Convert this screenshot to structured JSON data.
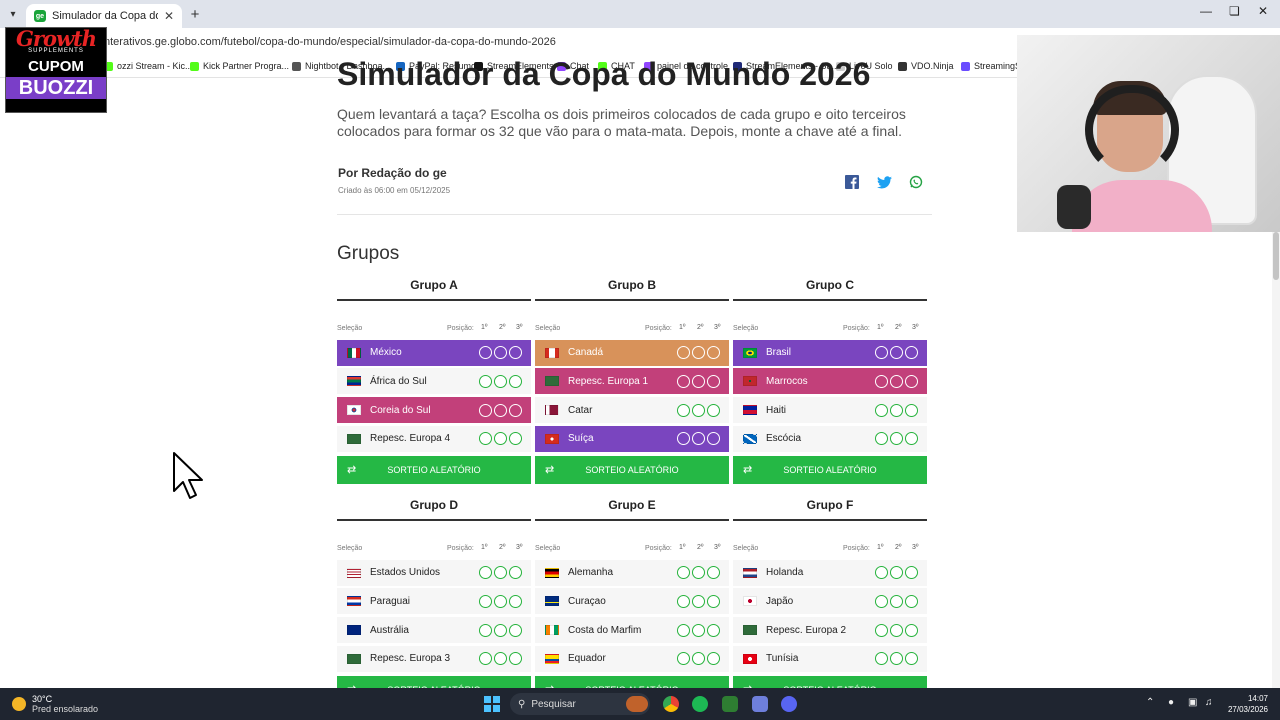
{
  "browser": {
    "tab_title": "Simulador da Copa do Mundo",
    "favicon_label": "ge",
    "url": "nterativos.ge.globo.com/futebol/copa-do-mundo/especial/simulador-da-copa-do-mundo-2026",
    "bookmarks": [
      {
        "label": "ozzi Stream - Kic...",
        "color": "#53fc18"
      },
      {
        "label": "Kick Partner Progra...",
        "color": "#53fc18"
      },
      {
        "label": "Nightbot - Dashboa...",
        "color": "#555555"
      },
      {
        "label": "PayPal: Resumo",
        "color": "#1565c0"
      },
      {
        "label": "StreamElements",
        "color": "#111111"
      },
      {
        "label": "Chat",
        "color": "#9146ff"
      },
      {
        "label": "CHAT",
        "color": "#53fc18"
      },
      {
        "label": "painel de controle",
        "color": "#9146ff"
      },
      {
        "label": "StreamElements - St...",
        "color": "#1f2a78"
      },
      {
        "label": "LiveU Solo",
        "color": "#cccccc"
      },
      {
        "label": "VDO.Ninja",
        "color": "#333333"
      },
      {
        "label": "StreamingS",
        "color": "#6a4cff"
      }
    ]
  },
  "sponsor": {
    "brand": "Growth",
    "sub": "SUPPLEMENTS",
    "cupom": "CUPOM",
    "code": "BUOZZI"
  },
  "page": {
    "title": "Simulador da Copa do Mundo 2026",
    "lead": "Quem levantará a taça? Escolha os dois primeiros colocados de cada grupo e oito terceiros colocados para formar os 32 que vão para o mata-mata. Depois, monte a chave até a final.",
    "author": "Por Redação do ge",
    "created": "Criado às 06:00 em 05/12/2025",
    "section_title": "Grupos",
    "selection_label": "Seleção",
    "position_label": "Posição:",
    "pos_labels": [
      "1º",
      "2º",
      "3º"
    ],
    "random_label": "SORTEIO ALEATÓRIO"
  },
  "colors": {
    "first": "#7a45bf",
    "second": "#c2407a",
    "third": "#d8925a",
    "green": "#25b845"
  },
  "groups": [
    {
      "name": "Grupo A",
      "teams": [
        {
          "name": "México",
          "sel": 1,
          "flag": "mx"
        },
        {
          "name": "África do Sul",
          "sel": 0,
          "flag": "za"
        },
        {
          "name": "Coreia do Sul",
          "sel": 2,
          "flag": "kr"
        },
        {
          "name": "Repesc. Europa 4",
          "sel": 0,
          "flag": "pl"
        }
      ]
    },
    {
      "name": "Grupo B",
      "teams": [
        {
          "name": "Canadá",
          "sel": 3,
          "flag": "ca"
        },
        {
          "name": "Repesc. Europa 1",
          "sel": 2,
          "flag": "pl"
        },
        {
          "name": "Catar",
          "sel": 0,
          "flag": "qa"
        },
        {
          "name": "Suíça",
          "sel": 1,
          "flag": "ch"
        }
      ]
    },
    {
      "name": "Grupo C",
      "teams": [
        {
          "name": "Brasil",
          "sel": 1,
          "flag": "br"
        },
        {
          "name": "Marrocos",
          "sel": 2,
          "flag": "ma"
        },
        {
          "name": "Haiti",
          "sel": 0,
          "flag": "ht"
        },
        {
          "name": "Escócia",
          "sel": 0,
          "flag": "sc"
        }
      ]
    },
    {
      "name": "Grupo D",
      "teams": [
        {
          "name": "Estados Unidos",
          "sel": 0,
          "flag": "us"
        },
        {
          "name": "Paraguai",
          "sel": 0,
          "flag": "py"
        },
        {
          "name": "Austrália",
          "sel": 0,
          "flag": "au"
        },
        {
          "name": "Repesc. Europa 3",
          "sel": 0,
          "flag": "pl"
        }
      ]
    },
    {
      "name": "Grupo E",
      "teams": [
        {
          "name": "Alemanha",
          "sel": 0,
          "flag": "de"
        },
        {
          "name": "Curaçao",
          "sel": 0,
          "flag": "cw"
        },
        {
          "name": "Costa do Marfim",
          "sel": 0,
          "flag": "ci"
        },
        {
          "name": "Equador",
          "sel": 0,
          "flag": "ec"
        }
      ]
    },
    {
      "name": "Grupo F",
      "teams": [
        {
          "name": "Holanda",
          "sel": 0,
          "flag": "nl"
        },
        {
          "name": "Japão",
          "sel": 0,
          "flag": "jp"
        },
        {
          "name": "Repesc. Europa 2",
          "sel": 0,
          "flag": "pl"
        },
        {
          "name": "Tunísia",
          "sel": 0,
          "flag": "tn"
        }
      ]
    }
  ],
  "taskbar": {
    "temp": "30°C",
    "weather": "Pred ensolarado",
    "search": "Pesquisar",
    "time": "14:07",
    "date": "27/03/2026"
  }
}
